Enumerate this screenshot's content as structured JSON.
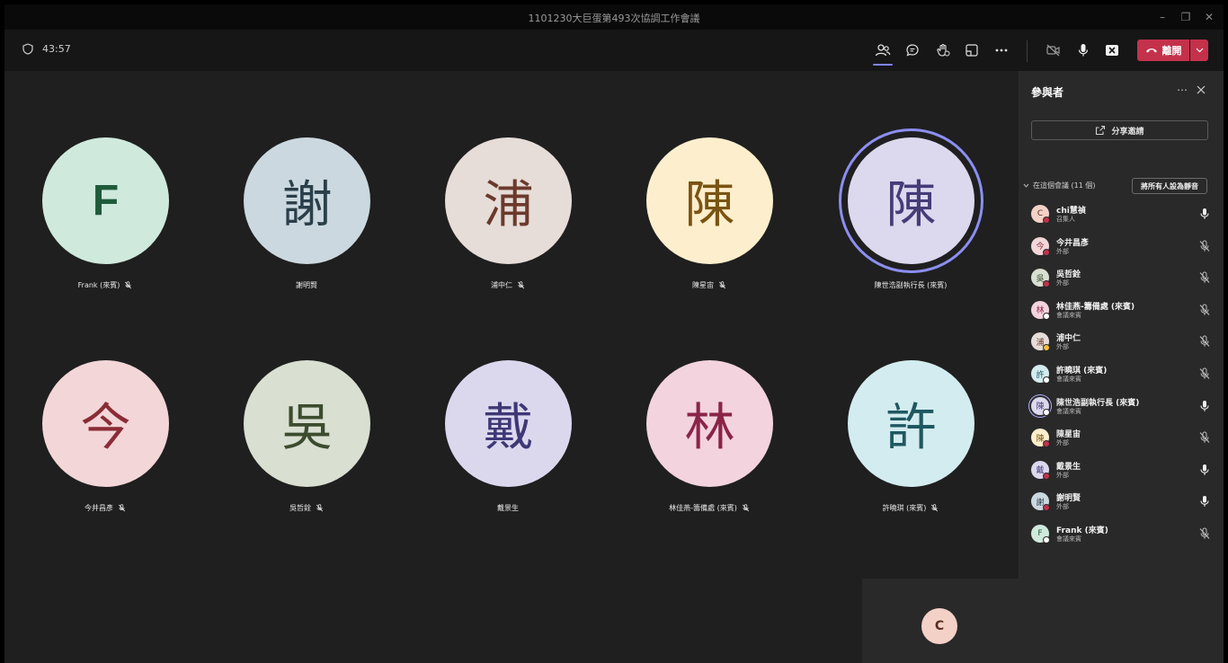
{
  "window": {
    "title": "1101230大巨蛋第493次協調工作會議"
  },
  "toolbar": {
    "timer": "43:57",
    "leave_label": "離開",
    "colors": {
      "leave": "#c4314b",
      "accent": "#7f85f5"
    }
  },
  "tiles": [
    {
      "initial": "F",
      "name": "Frank (來賓)",
      "muted": true,
      "bg": "#cfe9dd",
      "fg": "#1f5b3a",
      "latin": true
    },
    {
      "initial": "謝",
      "name": "謝明賢",
      "muted": false,
      "bg": "#cbd8df",
      "fg": "#2b3f4a"
    },
    {
      "initial": "浦",
      "name": "浦中仁",
      "muted": true,
      "bg": "#e6dcd8",
      "fg": "#6b3a2c"
    },
    {
      "initial": "陳",
      "name": "陳星宙",
      "muted": true,
      "bg": "#fdefcd",
      "fg": "#7a5412"
    },
    {
      "initial": "陳",
      "name": "陳世浩副執行長 (來賓)",
      "muted": false,
      "bg": "#dcd8ee",
      "fg": "#463c78",
      "speaking": true
    },
    {
      "initial": "今",
      "name": "今井昌彥",
      "muted": true,
      "bg": "#f3d6d8",
      "fg": "#8a2c36"
    },
    {
      "initial": "吳",
      "name": "吳哲銓",
      "muted": true,
      "bg": "#d9dfd1",
      "fg": "#3c4c2e"
    },
    {
      "initial": "戴",
      "name": "戴景生",
      "muted": false,
      "bg": "#dbd8ee",
      "fg": "#3e3876"
    },
    {
      "initial": "林",
      "name": "林佳燕-籌備處 (來賓)",
      "muted": true,
      "bg": "#f3d3de",
      "fg": "#8a2448"
    },
    {
      "initial": "許",
      "name": "許曉琪 (來賓)",
      "muted": true,
      "bg": "#d3ecef",
      "fg": "#1f5860"
    }
  ],
  "self_view": {
    "initial": "C"
  },
  "panel": {
    "title": "參與者",
    "share_label": "分享邀請",
    "section_label": "在這個會議 (11 個)",
    "mute_all_label": "將所有人設為靜音",
    "participants": [
      {
        "initial": "C",
        "name": "chi慧禎",
        "role": "召集人",
        "bg": "#f4d1c7",
        "fg": "#5a2c20",
        "status": "#c4314b",
        "mic": "on"
      },
      {
        "initial": "今",
        "name": "今井昌彥",
        "role": "外部",
        "bg": "#f3d6d8",
        "fg": "#8a2c36",
        "status": "#c4314b",
        "mic": "off"
      },
      {
        "initial": "吳",
        "name": "吳哲銓",
        "role": "外部",
        "bg": "#d9dfd1",
        "fg": "#3c4c2e",
        "status": "#c4314b",
        "mic": "off"
      },
      {
        "initial": "林",
        "name": "林佳燕-籌備處 (來賓)",
        "role": "會議來賓",
        "bg": "#f3d3de",
        "fg": "#8a2448",
        "status": "#ffffff",
        "mic": "off"
      },
      {
        "initial": "浦",
        "name": "浦中仁",
        "role": "外部",
        "bg": "#e6dcd8",
        "fg": "#6b3a2c",
        "status": "#f8c33a",
        "mic": "off"
      },
      {
        "initial": "許",
        "name": "許曉琪 (來賓)",
        "role": "會議來賓",
        "bg": "#d3ecef",
        "fg": "#1f5860",
        "status": "#ffffff",
        "mic": "off"
      },
      {
        "initial": "陳",
        "name": "陳世浩副執行長 (來賓)",
        "role": "會議來賓",
        "bg": "#dcd8ee",
        "fg": "#463c78",
        "status": "#ffffff",
        "mic": "on",
        "speaking": true
      },
      {
        "initial": "陳",
        "name": "陳星宙",
        "role": "外部",
        "bg": "#fdefcd",
        "fg": "#7a5412",
        "status": "#c4314b",
        "mic": "off"
      },
      {
        "initial": "戴",
        "name": "戴景生",
        "role": "外部",
        "bg": "#dbd8ee",
        "fg": "#3e3876",
        "status": "#c4314b",
        "mic": "on"
      },
      {
        "initial": "謝",
        "name": "謝明賢",
        "role": "外部",
        "bg": "#cbd8df",
        "fg": "#2b3f4a",
        "status": "#c4314b",
        "mic": "on"
      },
      {
        "initial": "F",
        "name": "Frank (來賓)",
        "role": "會議來賓",
        "bg": "#cfe9dd",
        "fg": "#1f5b3a",
        "status": "#ffffff",
        "mic": "off"
      }
    ]
  }
}
